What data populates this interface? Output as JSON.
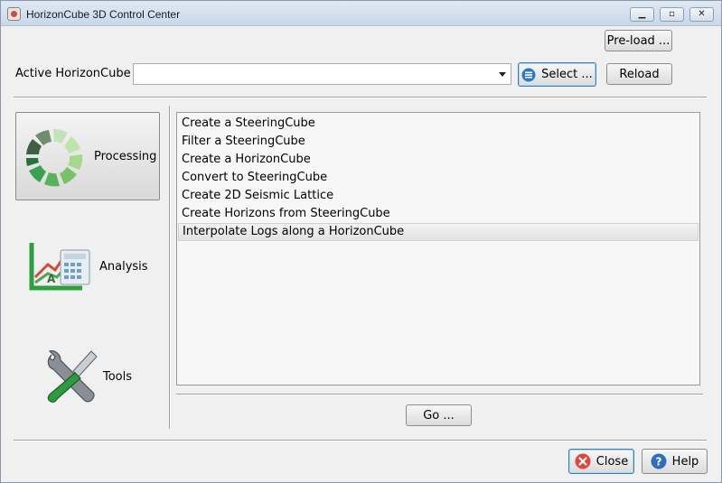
{
  "window": {
    "title": "HorizonCube 3D Control Center",
    "controls": {
      "minimize": "▁",
      "maximize": "▫",
      "close": "✕"
    }
  },
  "header": {
    "preload_label": "Pre-load ...",
    "active_label": "Active HorizonCube",
    "active_value": "",
    "select_label": "Select ...",
    "reload_label": "Reload"
  },
  "sidebar": {
    "items": [
      {
        "label": "Processing",
        "icon": "processing-icon",
        "active": true
      },
      {
        "label": "Analysis",
        "icon": "analysis-chart-icon",
        "active": false
      },
      {
        "label": "Tools",
        "icon": "tools-wrench-screwdriver-icon",
        "active": false
      }
    ]
  },
  "main": {
    "list_items": [
      "Create a SteeringCube",
      "Filter a SteeringCube",
      "Create a HorizonCube",
      "Convert to SteeringCube",
      "Create 2D Seismic Lattice",
      "Create Horizons from SteeringCube",
      "Interpolate Logs along a HorizonCube"
    ],
    "hovered_index": 6,
    "go_label": "Go ..."
  },
  "footer": {
    "close_label": "Close",
    "help_label": "Help"
  },
  "colors": {
    "titlebar": "#c9d8ea",
    "window_bg": "#f0f0f0",
    "accent_blue": "#3a7fc1",
    "close_red": "#e0443e",
    "processing_green_dark": "#2f6b3b",
    "processing_green_light": "#b9dca6"
  }
}
